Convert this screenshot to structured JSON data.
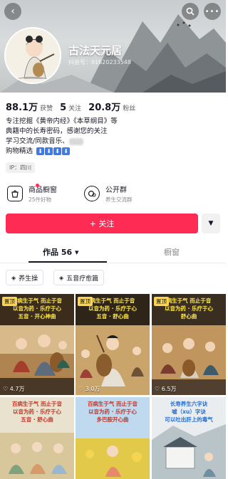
{
  "profile": {
    "name": "古法天元居",
    "douyin_id": "抖音号：91620233548"
  },
  "stats": [
    {
      "value": "88.1万",
      "label": "获赞"
    },
    {
      "value": "5",
      "label": "关注"
    },
    {
      "value": "20.8万",
      "label": "粉丝"
    }
  ],
  "bio": {
    "line1": "专注挖掘《黄帝内经》《本草纲目》等",
    "line2": "典籍中的长寿密码，感谢您的关注",
    "line3": "学习交流/同款音乐",
    "line4": "购物精选",
    "cubes": [
      "⬇",
      "⬇",
      "⬇",
      "⬇"
    ]
  },
  "ip": "IP：四川",
  "cards": {
    "shop_title": "商品橱窗",
    "shop_sub": "25件好物",
    "group_title": "公开群",
    "group_sub": "养生交流群"
  },
  "follow_label": "+ 关注",
  "more_label": "▼",
  "tabs": {
    "works": "作品 56 ▾",
    "likes": "橱窗"
  },
  "chips": [
    "养生操",
    "五音疗愈篇"
  ],
  "videos": [
    {
      "title": "肺病生于气 而止于音\n以音为药 · 乐疗于心\n五音 · 开心神曲",
      "pinned": "置顶",
      "likes": "4.7万"
    },
    {
      "title": "病生于气 而止于音\n以音为药 · 乐疗于心\n五音 · 舒心曲",
      "pinned": "置顶",
      "likes": "3.0万"
    },
    {
      "title": "病生于气 而止于音\n以音为药 · 乐疗于心\n舒心曲",
      "pinned": "置顶",
      "likes": "6.5万"
    },
    {
      "title": "百病生于气 而止于音\n以音为药 · 乐疗于心\n五音 · 舒心曲",
      "pinned": "",
      "likes": ""
    },
    {
      "title": "百病生于气 而止于音\n以音为药 · 乐疗于心\n多巴胺开心曲",
      "pinned": "",
      "likes": ""
    },
    {
      "title": "长寿养生六字诀\n嘘（xu）字诀\n可以吐出肝上的毒气",
      "pinned": "",
      "likes": ""
    }
  ],
  "colors": {
    "accent": "#fe2c55",
    "pin": "#fbd54f",
    "caption": "#ffe94a"
  }
}
